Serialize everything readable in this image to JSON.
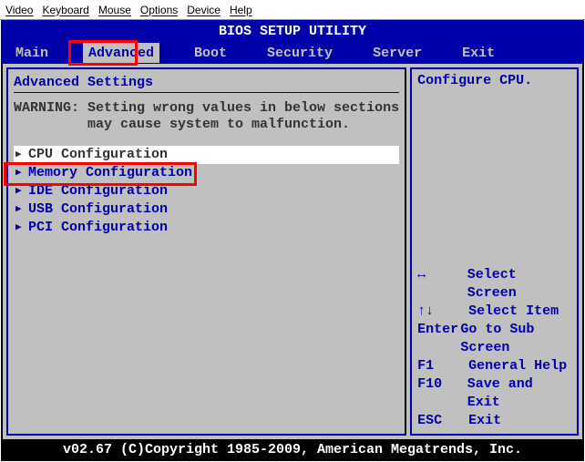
{
  "host_menu": {
    "items": [
      "Video",
      "Keyboard",
      "Mouse",
      "Options",
      "Device",
      "Help"
    ]
  },
  "title": "BIOS SETUP UTILITY",
  "tabs": [
    {
      "label": "Main",
      "active": false
    },
    {
      "label": "Advanced",
      "active": true
    },
    {
      "label": "Boot",
      "active": false
    },
    {
      "label": "Security",
      "active": false
    },
    {
      "label": "Server",
      "active": false
    },
    {
      "label": "Exit",
      "active": false
    }
  ],
  "left": {
    "heading": "Advanced Settings",
    "warning_line1": "WARNING: Setting wrong values in below sections",
    "warning_line2": "         may cause system to malfunction.",
    "items": [
      {
        "label": "CPU Configuration",
        "selected": true
      },
      {
        "label": "Memory Configuration",
        "selected": false
      },
      {
        "label": "IDE Configuration",
        "selected": false
      },
      {
        "label": "USB Configuration",
        "selected": false
      },
      {
        "label": "PCI Configuration",
        "selected": false
      }
    ]
  },
  "right": {
    "help": "Configure CPU.",
    "keys": [
      {
        "k": "↔",
        "d": "Select Screen"
      },
      {
        "k": "↑↓",
        "d": "Select Item"
      },
      {
        "k": "Enter",
        "d": "Go to Sub Screen"
      },
      {
        "k": "F1",
        "d": "General Help"
      },
      {
        "k": "F10",
        "d": "Save and Exit"
      },
      {
        "k": "ESC",
        "d": "Exit"
      }
    ]
  },
  "footer": "v02.67 (C)Copyright 1985-2009, American Megatrends, Inc.",
  "colors": {
    "blue": "#0000aa",
    "panel": "#c0c0c0",
    "highlight": "#ff0000"
  }
}
